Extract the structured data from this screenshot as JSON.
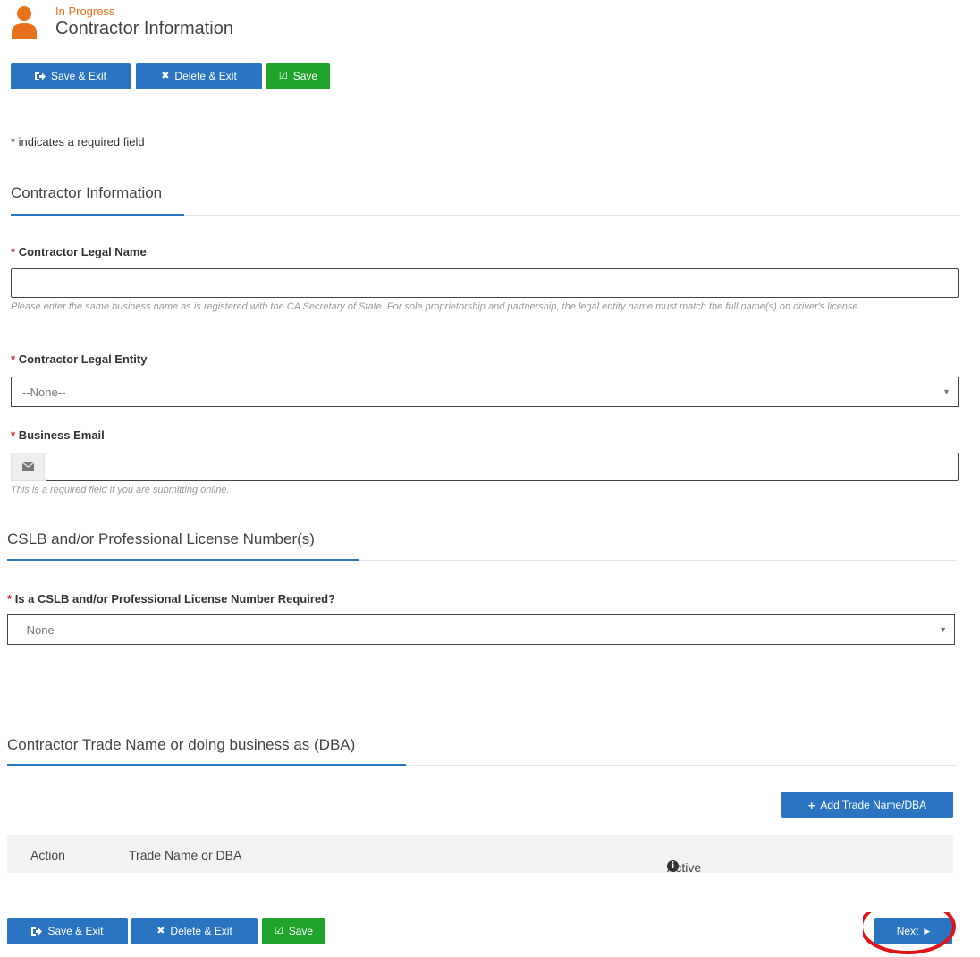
{
  "header": {
    "status": "In Progress",
    "title": "Contractor Information"
  },
  "top_toolbar": {
    "save_exit": "Save & Exit",
    "delete_exit": "Delete & Exit",
    "save": "Save"
  },
  "required_note": "* indicates a required field",
  "section_contractor": {
    "title": "Contractor Information",
    "legal_name": {
      "label": "Contractor Legal Name",
      "value": "",
      "help": "Please enter the same business name as is registered with the CA Secretary of State. For sole proprietorship and partnership, the legal entity name must match the full name(s) on driver's license."
    },
    "legal_entity": {
      "label": "Contractor Legal Entity",
      "selected": "--None--"
    },
    "business_email": {
      "label": "Business Email",
      "value": "",
      "help": "This is a required field if you are submitting online."
    }
  },
  "section_license": {
    "title": "CSLB and/or Professional License Number(s)",
    "license_required": {
      "label": "Is a CSLB and/or Professional License Number Required?",
      "selected": "--None--"
    }
  },
  "section_dba": {
    "title": "Contractor Trade Name or doing business as (DBA)",
    "add_button": "Add Trade Name/DBA",
    "columns": [
      "Action",
      "Trade Name or DBA",
      "Active"
    ]
  },
  "bottom_toolbar": {
    "save_exit": "Save & Exit",
    "delete_exit": "Delete & Exit",
    "save": "Save",
    "next": "Next"
  },
  "colors": {
    "accent_orange": "#e8721c",
    "primary_blue": "#2a74c1",
    "success_green": "#20a32a",
    "required_red": "#c0262d",
    "annotation_red": "#e0151b"
  },
  "icons": {
    "status": "person-icon",
    "save_exit": "sign-out-icon",
    "delete_exit": "close-icon",
    "save": "check-square-icon",
    "email": "envelope-icon",
    "add": "plus-icon",
    "info": "info-circle-icon",
    "next": "caret-right-icon",
    "select": "caret-down-icon"
  }
}
